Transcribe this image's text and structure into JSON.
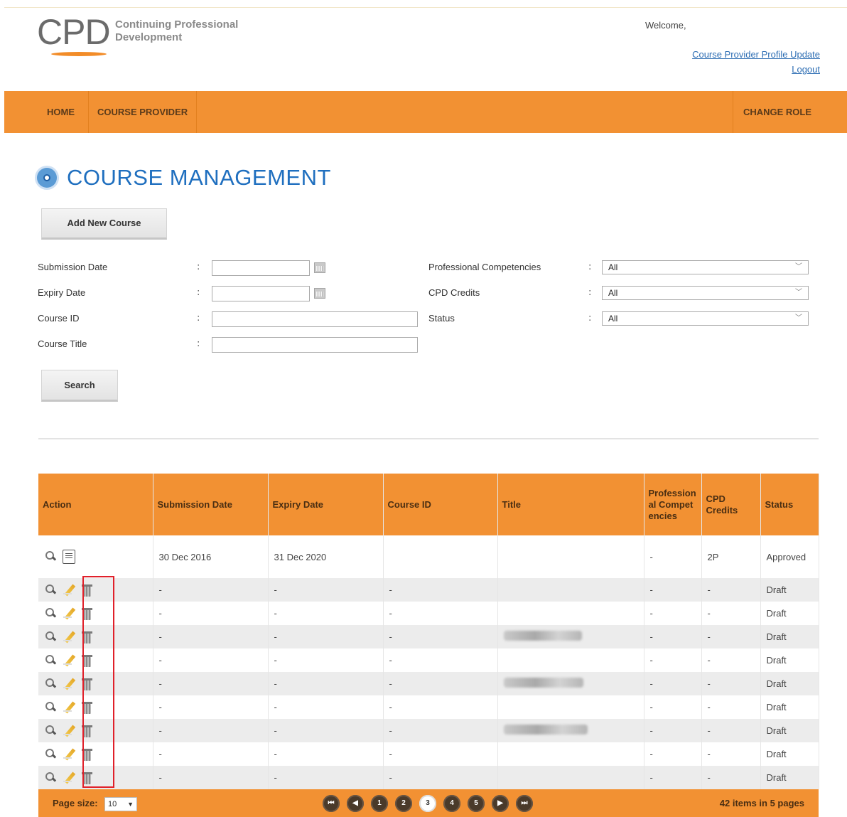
{
  "header": {
    "logo_mark": "CPD",
    "logo_text": "Continuing Professional Development",
    "welcome": "Welcome,",
    "profile_link": "Course Provider Profile Update",
    "logout_link": "Logout"
  },
  "nav": {
    "home": "HOME",
    "provider": "COURSE PROVIDER",
    "change_role": "CHANGE ROLE"
  },
  "page": {
    "title": "COURSE MANAGEMENT",
    "add_button": "Add New Course",
    "search_button": "Search"
  },
  "form": {
    "submission_date": "Submission Date",
    "expiry_date": "Expiry Date",
    "course_id": "Course ID",
    "course_title": "Course Title",
    "prof_comp": "Professional Competencies",
    "cpd_credits": "CPD Credits",
    "status": "Status",
    "prof_comp_value": "All",
    "cpd_credits_value": "All",
    "status_value": "All",
    "colon": ":"
  },
  "table": {
    "headers": [
      "Action",
      "Submission Date",
      "Expiry Date",
      "Course ID",
      "Title",
      "Professional Competencies",
      "CPD Credits",
      "Status"
    ],
    "rows": [
      {
        "sub": "30 Dec 2016",
        "exp": "31 Dec 2020",
        "cid": "",
        "title": "",
        "pc": "-",
        "cpd": "2P",
        "status": "Approved"
      },
      {
        "sub": "-",
        "exp": "-",
        "cid": "-",
        "title": "",
        "pc": "-",
        "cpd": "-",
        "status": "Draft"
      },
      {
        "sub": "-",
        "exp": "-",
        "cid": "-",
        "title": "",
        "pc": "-",
        "cpd": "-",
        "status": "Draft"
      },
      {
        "sub": "-",
        "exp": "-",
        "cid": "-",
        "title": "",
        "pc": "-",
        "cpd": "-",
        "status": "Draft"
      },
      {
        "sub": "-",
        "exp": "-",
        "cid": "-",
        "title": "",
        "pc": "-",
        "cpd": "-",
        "status": "Draft"
      },
      {
        "sub": "-",
        "exp": "-",
        "cid": "-",
        "title": "",
        "pc": "-",
        "cpd": "-",
        "status": "Draft"
      },
      {
        "sub": "-",
        "exp": "-",
        "cid": "-",
        "title": "",
        "pc": "-",
        "cpd": "-",
        "status": "Draft"
      },
      {
        "sub": "-",
        "exp": "-",
        "cid": "-",
        "title": "",
        "pc": "-",
        "cpd": "-",
        "status": "Draft"
      },
      {
        "sub": "-",
        "exp": "-",
        "cid": "-",
        "title": "",
        "pc": "-",
        "cpd": "-",
        "status": "Draft"
      },
      {
        "sub": "-",
        "exp": "-",
        "cid": "-",
        "title": "",
        "pc": "-",
        "cpd": "-",
        "status": "Draft"
      }
    ]
  },
  "pager": {
    "page_size_label": "Page size:",
    "page_size": "10",
    "pages": [
      "1",
      "2",
      "3",
      "4",
      "5"
    ],
    "current_page": "3",
    "items_text": "42 items in 5 pages"
  },
  "colors": {
    "accent": "#f29133",
    "title_blue": "#1f6fbf",
    "highlight": "#e0202a"
  }
}
